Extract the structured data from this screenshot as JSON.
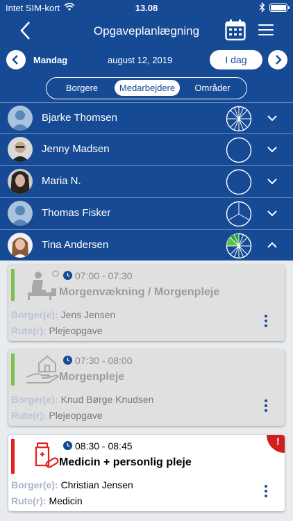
{
  "status": {
    "carrier": "Intet SIM-kort",
    "time": "13.08"
  },
  "nav": {
    "title": "Opgaveplanlægning"
  },
  "date_bar": {
    "day": "Mandag",
    "date": "august 12, 2019",
    "today_label": "I dag"
  },
  "segments": [
    {
      "label": "Borgere",
      "selected": false
    },
    {
      "label": "Medarbejdere",
      "selected": true
    },
    {
      "label": "Områder",
      "selected": false
    }
  ],
  "employees": [
    {
      "name": "Bjarke Thomsen",
      "expanded": false
    },
    {
      "name": "Jenny Madsen",
      "expanded": false
    },
    {
      "name": "Maria  N.",
      "expanded": false
    },
    {
      "name": "Thomas Fisker",
      "expanded": false
    },
    {
      "name": "Tina Andersen",
      "expanded": true
    }
  ],
  "tasks": [
    {
      "time": "07:00 - 07:30",
      "title": "Morgenvækning / Morgenpleje",
      "borger_label": "Borger(e):",
      "borger": "Jens Jensen",
      "rute_label": "Rute(r):",
      "rute": "Plejeopgave",
      "status_color": "#7cc04b",
      "icon": "wake-up-icon"
    },
    {
      "time": "07:30 - 08:00",
      "title": "Morgenpleje",
      "borger_label": "Borger(e):",
      "borger": "Knud Børge Knudsen",
      "rute_label": "Rute(r):",
      "rute": "Plejeopgave",
      "status_color": "#7cc04b",
      "icon": "home-care-icon"
    },
    {
      "time": "08:30 - 08:45",
      "title": "Medicin + personlig pleje",
      "borger_label": "Borger(e):",
      "borger": "Christian Jensen",
      "rute_label": "Rute(r):",
      "rute": "Medicin",
      "status_color": "#e2201a",
      "icon": "medicine-icon",
      "alert": "!"
    }
  ],
  "colors": {
    "primary": "#174a94",
    "done": "#7cc04b",
    "alert": "#e2201a"
  }
}
